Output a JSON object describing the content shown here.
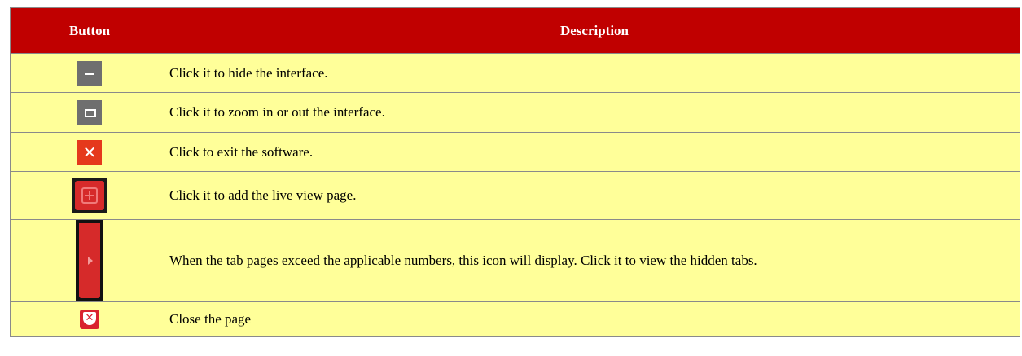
{
  "table": {
    "headers": {
      "button": "Button",
      "description": "Description"
    },
    "rows": [
      {
        "icon": "minimize-icon",
        "description": "Click it to hide the interface."
      },
      {
        "icon": "maximize-icon",
        "description": "Click it to zoom in or out the interface."
      },
      {
        "icon": "close-icon",
        "close_glyph": "✕",
        "description": "Click to exit the software."
      },
      {
        "icon": "add-page-icon",
        "description": "Click it to add the live view page."
      },
      {
        "icon": "tab-scroll-arrow-icon",
        "description": "When the tab pages exceed the applicable numbers, this icon will display. Click it to view the hidden tabs."
      },
      {
        "icon": "close-page-icon",
        "close_glyph": "✕",
        "description": "Close the page"
      }
    ]
  },
  "colors": {
    "header_bg": "#c00000",
    "row_bg": "#ffff99",
    "icon_gray": "#6f6f6f",
    "icon_red": "#e5391c"
  }
}
